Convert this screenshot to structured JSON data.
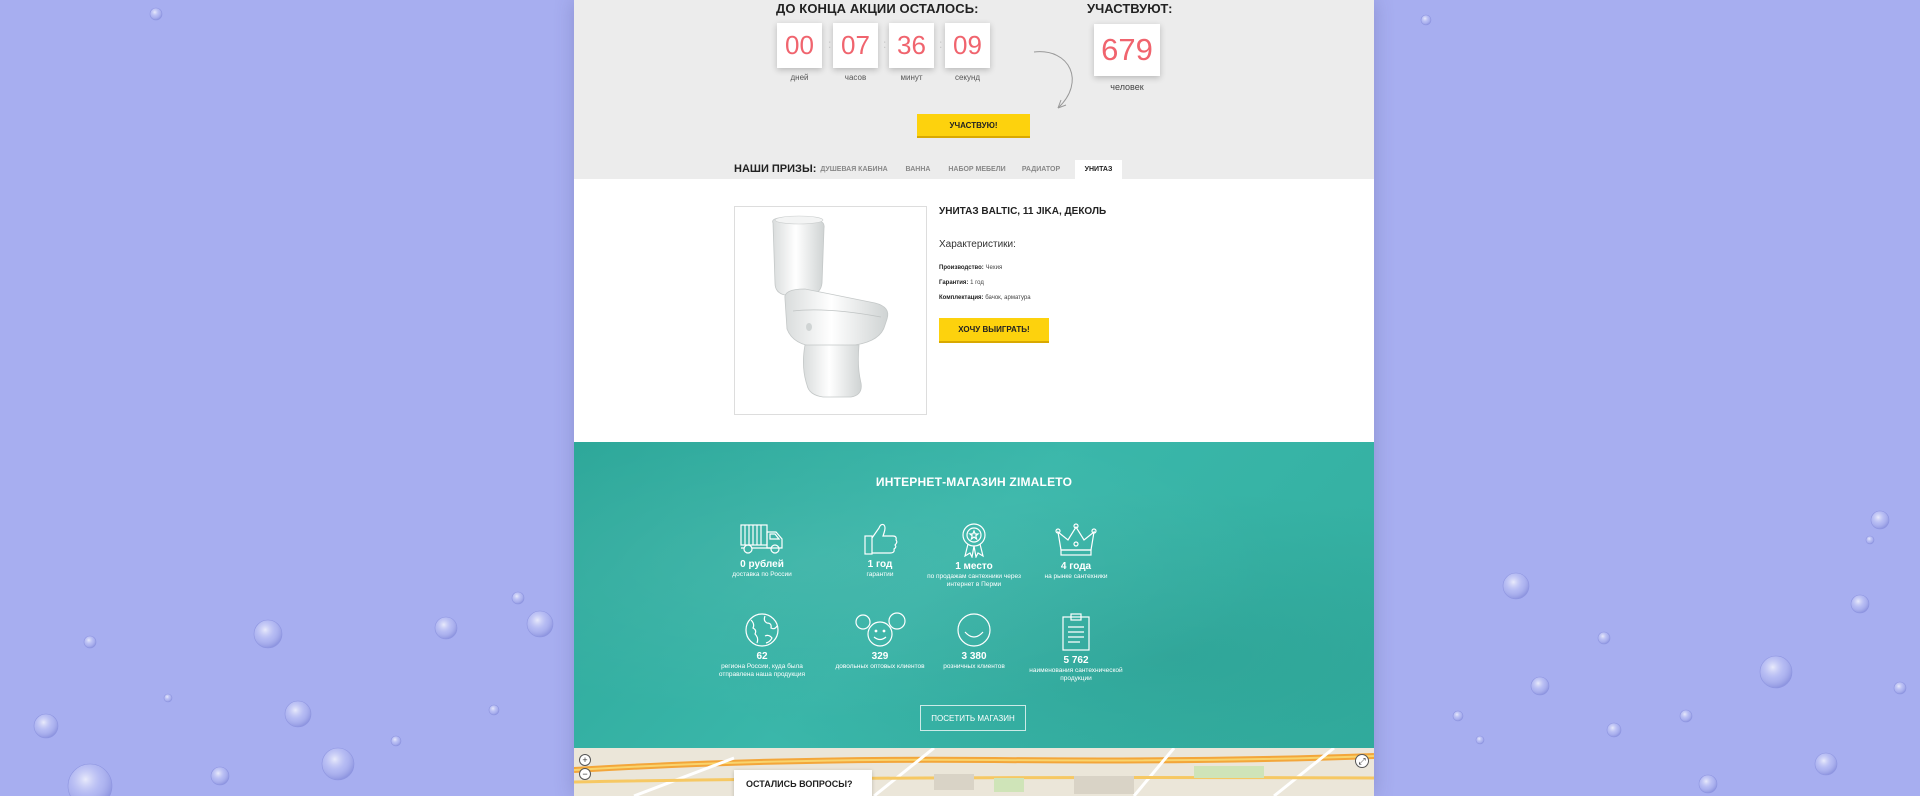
{
  "timer": {
    "title": "ДО КОНЦА АКЦИИ ОСТАЛОСЬ:",
    "units": [
      {
        "value": "00",
        "label": "дней"
      },
      {
        "value": "07",
        "label": "часов"
      },
      {
        "value": "36",
        "label": "минут"
      },
      {
        "value": "09",
        "label": "секунд"
      }
    ]
  },
  "participants": {
    "title": "УЧАСТВУЮТ:",
    "value": "679",
    "label": "человек"
  },
  "participate_button": "УЧАСТВУЮ!",
  "prizes": {
    "label": "НАШИ ПРИЗЫ:",
    "tabs": [
      "ДУШЕВАЯ КАБИНА",
      "ВАННА",
      "НАБОР МЕБЕЛИ",
      "РАДИАТОР",
      "УНИТАЗ"
    ],
    "active_tab": "УНИТАЗ"
  },
  "product": {
    "title": "УНИТАЗ BALTIC, 11 JIKA, ДЕКОЛЬ",
    "characteristics_title": "Характеристики:",
    "specs": [
      {
        "key": "Производство:",
        "value": "Чехия"
      },
      {
        "key": "Гарантия:",
        "value": "1 год"
      },
      {
        "key": "Комплектация:",
        "value": "бачок, арматура"
      }
    ],
    "button": "ХОЧУ ВЫИГРАТЬ!"
  },
  "shop": {
    "title": "ИНТЕРНЕТ-МАГАЗИН ZIMALETO",
    "features": [
      {
        "icon": "truck-icon",
        "value": "0 рублей",
        "desc": "доставка по России"
      },
      {
        "icon": "thumbs-up-icon",
        "value": "1 год",
        "desc": "гарантии"
      },
      {
        "icon": "medal-icon",
        "value": "1 место",
        "desc": "по продажам сантехники через интернет в Перми"
      },
      {
        "icon": "crown-icon",
        "value": "4 года",
        "desc": "на рынке сантехники"
      },
      {
        "icon": "globe-icon",
        "value": "62",
        "desc": "региона России, куда была отправлена наша продукция"
      },
      {
        "icon": "faces-icon",
        "value": "329",
        "desc": "довольных оптовых клиентов"
      },
      {
        "icon": "smile-icon",
        "value": "3 380",
        "desc": "розничных клиентов"
      },
      {
        "icon": "clipboard-icon",
        "value": "5 762",
        "desc": "наименования сантехнической продукции"
      }
    ],
    "visit_button": "ПОСЕТИТЬ МАГАЗИН"
  },
  "map": {
    "card_title": "ОСТАЛИСЬ ВОПРОСЫ?"
  },
  "colors": {
    "accent_red": "#f0646e",
    "yellow": "#fdd20d",
    "teal": "#35b0a2",
    "background": "#a7aef0"
  }
}
